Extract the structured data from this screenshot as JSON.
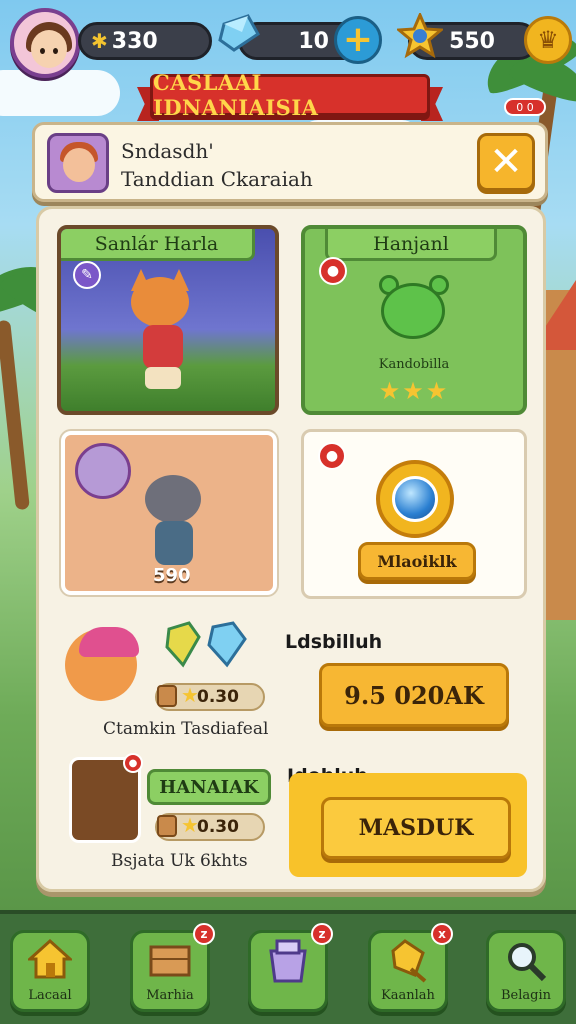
{
  "hud": {
    "gold_value": "330",
    "gems_value": "10",
    "coins_value": "550"
  },
  "banner": {
    "title": "CASLAAI IDNANIAISIA"
  },
  "notification_tag": "0 0",
  "info": {
    "line1": "Sndasdh'",
    "line2": "Tanddian Ckaraiah",
    "close_label": "✕"
  },
  "cards": {
    "hero": {
      "label": "Sanlár Harla"
    },
    "pet": {
      "label": "Hanjanl",
      "caption": "Kandobilla",
      "stars": "★★★"
    },
    "cat": {
      "price": "590"
    },
    "medal": {
      "button_label": "Mlaoiklk"
    }
  },
  "rows": {
    "first": {
      "side_label": "Ldsbilluh",
      "stats_value": "0.30",
      "caption": "Ctamkin Tasdiafeal",
      "button_label": "9.5 020AK"
    },
    "second": {
      "side_label": "Idohluh",
      "tag_label": "HANAIAK",
      "stats_value": "0.30",
      "caption": "Bsjata Uk 6khts",
      "button_label": "MASDUK"
    }
  },
  "nav": {
    "items": [
      {
        "label": "Lacaal",
        "icon": "house-icon",
        "badge": ""
      },
      {
        "label": "Marhia",
        "icon": "crate-icon",
        "badge": "z"
      },
      {
        "label": "",
        "icon": "gift-box-icon",
        "badge": "z"
      },
      {
        "label": "Kaanlah",
        "icon": "gold-key-icon",
        "badge": "x"
      },
      {
        "label": "Belagin",
        "icon": "magnifier-icon",
        "badge": ""
      }
    ]
  },
  "colors": {
    "accent_red": "#d7312b",
    "accent_gold": "#f7b733",
    "panel": "#f7f2e4",
    "nav_green": "#6fb64a"
  }
}
